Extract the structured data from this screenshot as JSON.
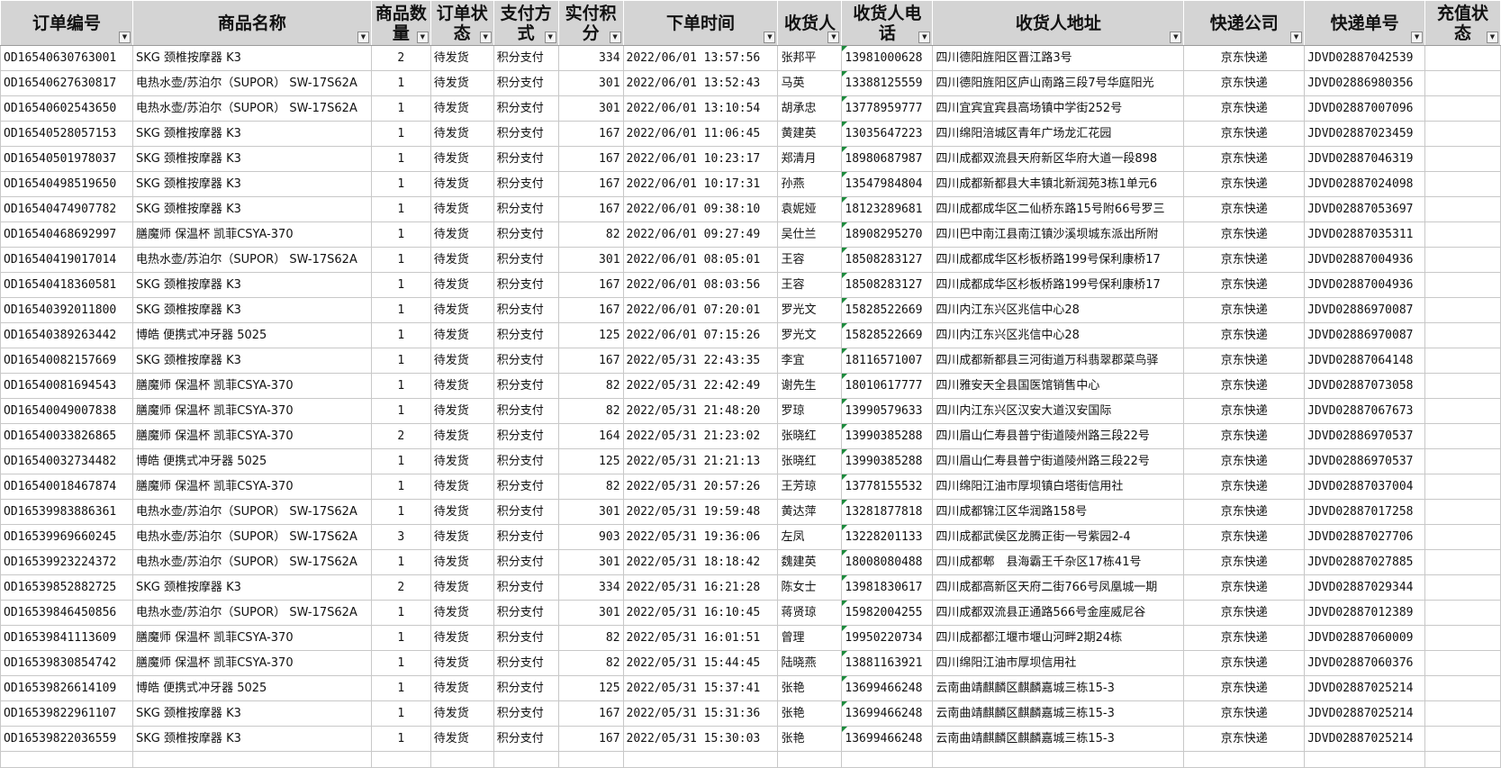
{
  "headers": [
    {
      "key": "order_id",
      "lines": [
        "订单编号"
      ],
      "align": "l"
    },
    {
      "key": "product",
      "lines": [
        "商品名称"
      ],
      "align": "l"
    },
    {
      "key": "qty",
      "lines": [
        "商品数",
        "量"
      ],
      "align": "c"
    },
    {
      "key": "status",
      "lines": [
        "订单状",
        "态"
      ],
      "align": "l"
    },
    {
      "key": "payment",
      "lines": [
        "支付方",
        "式"
      ],
      "align": "l"
    },
    {
      "key": "points",
      "lines": [
        "实付积",
        "分"
      ],
      "align": "r"
    },
    {
      "key": "time",
      "lines": [
        "下单时间"
      ],
      "align": "l"
    },
    {
      "key": "receiver",
      "lines": [
        "收货人"
      ],
      "align": "l"
    },
    {
      "key": "phone",
      "lines": [
        "收货人电",
        "话"
      ],
      "align": "l"
    },
    {
      "key": "address",
      "lines": [
        "收货人地址"
      ],
      "align": "l"
    },
    {
      "key": "courier",
      "lines": [
        "快递公司"
      ],
      "align": "c"
    },
    {
      "key": "tracking",
      "lines": [
        "快递单号"
      ],
      "align": "l"
    },
    {
      "key": "recharge",
      "lines": [
        "充值状",
        "态"
      ],
      "align": "l"
    }
  ],
  "rows": [
    [
      "OD16540630763001",
      "SKG 颈椎按摩器 K3",
      "2",
      "待发货",
      "积分支付",
      "334",
      "2022/06/01 13:57:56",
      "张邦平",
      "13981000628",
      "四川德阳旌阳区晋江路3号",
      "京东快递",
      "JDVD02887042539",
      ""
    ],
    [
      "OD16540627630817",
      "电热水壶/苏泊尔（SUPOR） SW-17S62A",
      "1",
      "待发货",
      "积分支付",
      "301",
      "2022/06/01 13:52:43",
      "马英",
      "13388125559",
      "四川德阳旌阳区庐山南路三段7号华庭阳光",
      "京东快递",
      "JDVD02886980356",
      ""
    ],
    [
      "OD16540602543650",
      "电热水壶/苏泊尔（SUPOR） SW-17S62A",
      "1",
      "待发货",
      "积分支付",
      "301",
      "2022/06/01 13:10:54",
      "胡承忠",
      "13778959777",
      "四川宜宾宜宾县高场镇中学街252号",
      "京东快递",
      "JDVD02887007096",
      ""
    ],
    [
      "OD16540528057153",
      "SKG 颈椎按摩器 K3",
      "1",
      "待发货",
      "积分支付",
      "167",
      "2022/06/01 11:06:45",
      "黄建英",
      "13035647223",
      "四川绵阳涪城区青年广场龙汇花园",
      "京东快递",
      "JDVD02887023459",
      ""
    ],
    [
      "OD16540501978037",
      "SKG 颈椎按摩器 K3",
      "1",
      "待发货",
      "积分支付",
      "167",
      "2022/06/01 10:23:17",
      "郑清月",
      "18980687987",
      "四川成都双流县天府新区华府大道一段898",
      "京东快递",
      "JDVD02887046319",
      ""
    ],
    [
      "OD16540498519650",
      "SKG 颈椎按摩器 K3",
      "1",
      "待发货",
      "积分支付",
      "167",
      "2022/06/01 10:17:31",
      "孙燕",
      "13547984804",
      "四川成都新都县大丰镇北新润苑3栋1单元6",
      "京东快递",
      "JDVD02887024098",
      ""
    ],
    [
      "OD16540474907782",
      "SKG 颈椎按摩器 K3",
      "1",
      "待发货",
      "积分支付",
      "167",
      "2022/06/01 09:38:10",
      "袁妮娅",
      "18123289681",
      "四川成都成华区二仙桥东路15号附66号罗三",
      "京东快递",
      "JDVD02887053697",
      ""
    ],
    [
      "OD16540468692997",
      "膳魔师 保温杯 凯菲CSYA-370",
      "1",
      "待发货",
      "积分支付",
      "82",
      "2022/06/01 09:27:49",
      "吴仕兰",
      "18908295270",
      "四川巴中南江县南江镇沙溪坝城东派出所附",
      "京东快递",
      "JDVD02887035311",
      ""
    ],
    [
      "OD16540419017014",
      "电热水壶/苏泊尔（SUPOR） SW-17S62A",
      "1",
      "待发货",
      "积分支付",
      "301",
      "2022/06/01 08:05:01",
      "王容",
      "18508283127",
      "四川成都成华区杉板桥路199号保利康桥17",
      "京东快递",
      "JDVD02887004936",
      ""
    ],
    [
      "OD16540418360581",
      "SKG 颈椎按摩器 K3",
      "1",
      "待发货",
      "积分支付",
      "167",
      "2022/06/01 08:03:56",
      "王容",
      "18508283127",
      "四川成都成华区杉板桥路199号保利康桥17",
      "京东快递",
      "JDVD02887004936",
      ""
    ],
    [
      "OD16540392011800",
      "SKG 颈椎按摩器 K3",
      "1",
      "待发货",
      "积分支付",
      "167",
      "2022/06/01 07:20:01",
      "罗光文",
      "15828522669",
      "四川内江东兴区兆信中心28",
      "京东快递",
      "JDVD02886970087",
      ""
    ],
    [
      "OD16540389263442",
      "博皓 便携式冲牙器 5025",
      "1",
      "待发货",
      "积分支付",
      "125",
      "2022/06/01 07:15:26",
      "罗光文",
      "15828522669",
      "四川内江东兴区兆信中心28",
      "京东快递",
      "JDVD02886970087",
      ""
    ],
    [
      "OD16540082157669",
      "SKG 颈椎按摩器 K3",
      "1",
      "待发货",
      "积分支付",
      "167",
      "2022/05/31 22:43:35",
      "李宜",
      "18116571007",
      "四川成都新都县三河街道万科翡翠郡菜鸟驿",
      "京东快递",
      "JDVD02887064148",
      ""
    ],
    [
      "OD16540081694543",
      "膳魔师 保温杯 凯菲CSYA-370",
      "1",
      "待发货",
      "积分支付",
      "82",
      "2022/05/31 22:42:49",
      "谢先生",
      "18010617777",
      "四川雅安天全县国医馆销售中心",
      "京东快递",
      "JDVD02887073058",
      ""
    ],
    [
      "OD16540049007838",
      "膳魔师 保温杯 凯菲CSYA-370",
      "1",
      "待发货",
      "积分支付",
      "82",
      "2022/05/31 21:48:20",
      "罗琼",
      "13990579633",
      "四川内江东兴区汉安大道汉安国际",
      "京东快递",
      "JDVD02887067673",
      ""
    ],
    [
      "OD16540033826865",
      "膳魔师 保温杯 凯菲CSYA-370",
      "2",
      "待发货",
      "积分支付",
      "164",
      "2022/05/31 21:23:02",
      "张晓红",
      "13990385288",
      "四川眉山仁寿县普宁街道陵州路三段22号",
      "京东快递",
      "JDVD02886970537",
      ""
    ],
    [
      "OD16540032734482",
      "博皓 便携式冲牙器 5025",
      "1",
      "待发货",
      "积分支付",
      "125",
      "2022/05/31 21:21:13",
      "张晓红",
      "13990385288",
      "四川眉山仁寿县普宁街道陵州路三段22号",
      "京东快递",
      "JDVD02886970537",
      ""
    ],
    [
      "OD16540018467874",
      "膳魔师 保温杯 凯菲CSYA-370",
      "1",
      "待发货",
      "积分支付",
      "82",
      "2022/05/31 20:57:26",
      "王芳琼",
      "13778155532",
      "四川绵阳江油市厚坝镇白塔街信用社",
      "京东快递",
      "JDVD02887037004",
      ""
    ],
    [
      "OD16539983886361",
      "电热水壶/苏泊尔（SUPOR） SW-17S62A",
      "1",
      "待发货",
      "积分支付",
      "301",
      "2022/05/31 19:59:48",
      "黄达萍",
      "13281877818",
      "四川成都锦江区华润路158号",
      "京东快递",
      "JDVD02887017258",
      ""
    ],
    [
      "OD16539969660245",
      "电热水壶/苏泊尔（SUPOR） SW-17S62A",
      "3",
      "待发货",
      "积分支付",
      "903",
      "2022/05/31 19:36:06",
      "左凤",
      "13228201133",
      "四川成都武侯区龙腾正街一号紫园2-4",
      "京东快递",
      "JDVD02887027706",
      ""
    ],
    [
      "OD16539923224372",
      "电热水壶/苏泊尔（SUPOR） SW-17S62A",
      "1",
      "待发货",
      "积分支付",
      "301",
      "2022/05/31 18:18:42",
      "魏建英",
      "18008080488",
      "四川成都郫　县海霸王千杂区17栋41号",
      "京东快递",
      "JDVD02887027885",
      ""
    ],
    [
      "OD16539852882725",
      "SKG 颈椎按摩器 K3",
      "2",
      "待发货",
      "积分支付",
      "334",
      "2022/05/31 16:21:28",
      "陈女士",
      "13981830617",
      "四川成都高新区天府二街766号凤凰城一期",
      "京东快递",
      "JDVD02887029344",
      ""
    ],
    [
      "OD16539846450856",
      "电热水壶/苏泊尔（SUPOR） SW-17S62A",
      "1",
      "待发货",
      "积分支付",
      "301",
      "2022/05/31 16:10:45",
      "蒋贤琼",
      "15982004255",
      "四川成都双流县正通路566号金座威尼谷",
      "京东快递",
      "JDVD02887012389",
      ""
    ],
    [
      "OD16539841113609",
      "膳魔师 保温杯 凯菲CSYA-370",
      "1",
      "待发货",
      "积分支付",
      "82",
      "2022/05/31 16:01:51",
      "曾理",
      "19950220734",
      "四川成都都江堰市堰山河畔2期24栋",
      "京东快递",
      "JDVD02887060009",
      ""
    ],
    [
      "OD16539830854742",
      "膳魔师 保温杯 凯菲CSYA-370",
      "1",
      "待发货",
      "积分支付",
      "82",
      "2022/05/31 15:44:45",
      "陆晓燕",
      "13881163921",
      "四川绵阳江油市厚坝信用社",
      "京东快递",
      "JDVD02887060376",
      ""
    ],
    [
      "OD16539826614109",
      "博皓 便携式冲牙器 5025",
      "1",
      "待发货",
      "积分支付",
      "125",
      "2022/05/31 15:37:41",
      "张艳",
      "13699466248",
      "云南曲靖麒麟区麒麟嘉城三栋15-3",
      "京东快递",
      "JDVD02887025214",
      ""
    ],
    [
      "OD16539822961107",
      "SKG 颈椎按摩器 K3",
      "1",
      "待发货",
      "积分支付",
      "167",
      "2022/05/31 15:31:36",
      "张艳",
      "13699466248",
      "云南曲靖麒麟区麒麟嘉城三栋15-3",
      "京东快递",
      "JDVD02887025214",
      ""
    ],
    [
      "OD16539822036559",
      "SKG 颈椎按摩器 K3",
      "1",
      "待发货",
      "积分支付",
      "167",
      "2022/05/31 15:30:03",
      "张艳",
      "13699466248",
      "云南曲靖麒麟区麒麟嘉城三栋15-3",
      "京东快递",
      "JDVD02887025214",
      ""
    ]
  ],
  "filter_icon": "filter-dropdown-icon",
  "accent_colors": {
    "header_bg": "#d4d4d4",
    "note_marker": "#1c8a3c",
    "grid": "#c8c8c8"
  }
}
